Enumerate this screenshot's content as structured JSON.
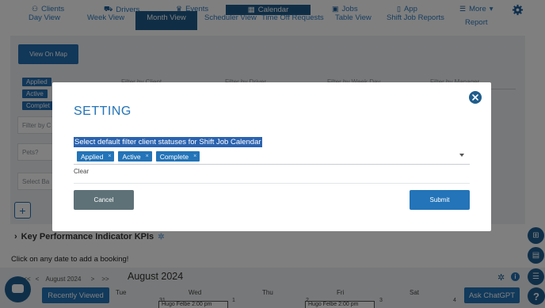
{
  "nav": {
    "items": [
      {
        "label": "Clients",
        "icon": "clients-icon",
        "glyph": "⚇"
      },
      {
        "label": "Drivers",
        "icon": "car-icon",
        "glyph": "⛟"
      },
      {
        "label": "Events",
        "icon": "trophy-icon",
        "glyph": "♛"
      },
      {
        "label": "Calendar",
        "icon": "calendar-icon",
        "glyph": "▦"
      },
      {
        "label": "Jobs",
        "icon": "briefcase-icon",
        "glyph": "▣"
      },
      {
        "label": "App",
        "icon": "mobile-icon",
        "glyph": "▯"
      },
      {
        "label": "More",
        "icon": "chat-icon",
        "glyph": "☰"
      }
    ],
    "more_caret": "▾",
    "views": [
      "Day View",
      "Week View",
      "Month View",
      "Scheduler View",
      "Time Off Requests",
      "Table View",
      "Shift Job Reports",
      "Report"
    ]
  },
  "background": {
    "view_on_map": "View On Map",
    "status_tags": [
      "Applied",
      "Active",
      "Complet"
    ],
    "filters": [
      "Filter by Client",
      "Filter by Driver",
      "Filter by Week Day",
      "Filter by Manager"
    ],
    "filter_client_partial": "Filter by C",
    "pets_placeholder": "Pets?",
    "select_partial": "Select Ba",
    "kpi_title": "Key Performance Indicator KPIs",
    "click_hint": "Click on any date to add a booking!",
    "calendar": {
      "prev_prev": "<<",
      "prev": "<",
      "month_select": "August 2024",
      "next": ">",
      "next_next": ">>",
      "month_title": "August 2024",
      "days": [
        "Tue",
        "Wed",
        "Thu",
        "Fri",
        "Sat"
      ],
      "day_numbers": [
        "31",
        "1",
        "2",
        "3",
        "4"
      ],
      "events": [
        "Hugo Felbe 2:00 pm",
        "Hugo Felbe 2:00 pm"
      ]
    },
    "recently_viewed": "Recently Viewed",
    "ask_chatgpt": "Ask ChatGPT",
    "help": "?"
  },
  "modal": {
    "title": "SETTING",
    "label": "Select default filter client statuses for Shift Job Calendar",
    "chips": [
      "Applied",
      "Active",
      "Complete"
    ],
    "chip_remove": "×",
    "clear": "Clear",
    "cancel": "Cancel",
    "submit": "Submit"
  },
  "colors": {
    "primary": "#2374b8",
    "nav_active": "#1f5d8c",
    "cancel": "#5e7177"
  }
}
